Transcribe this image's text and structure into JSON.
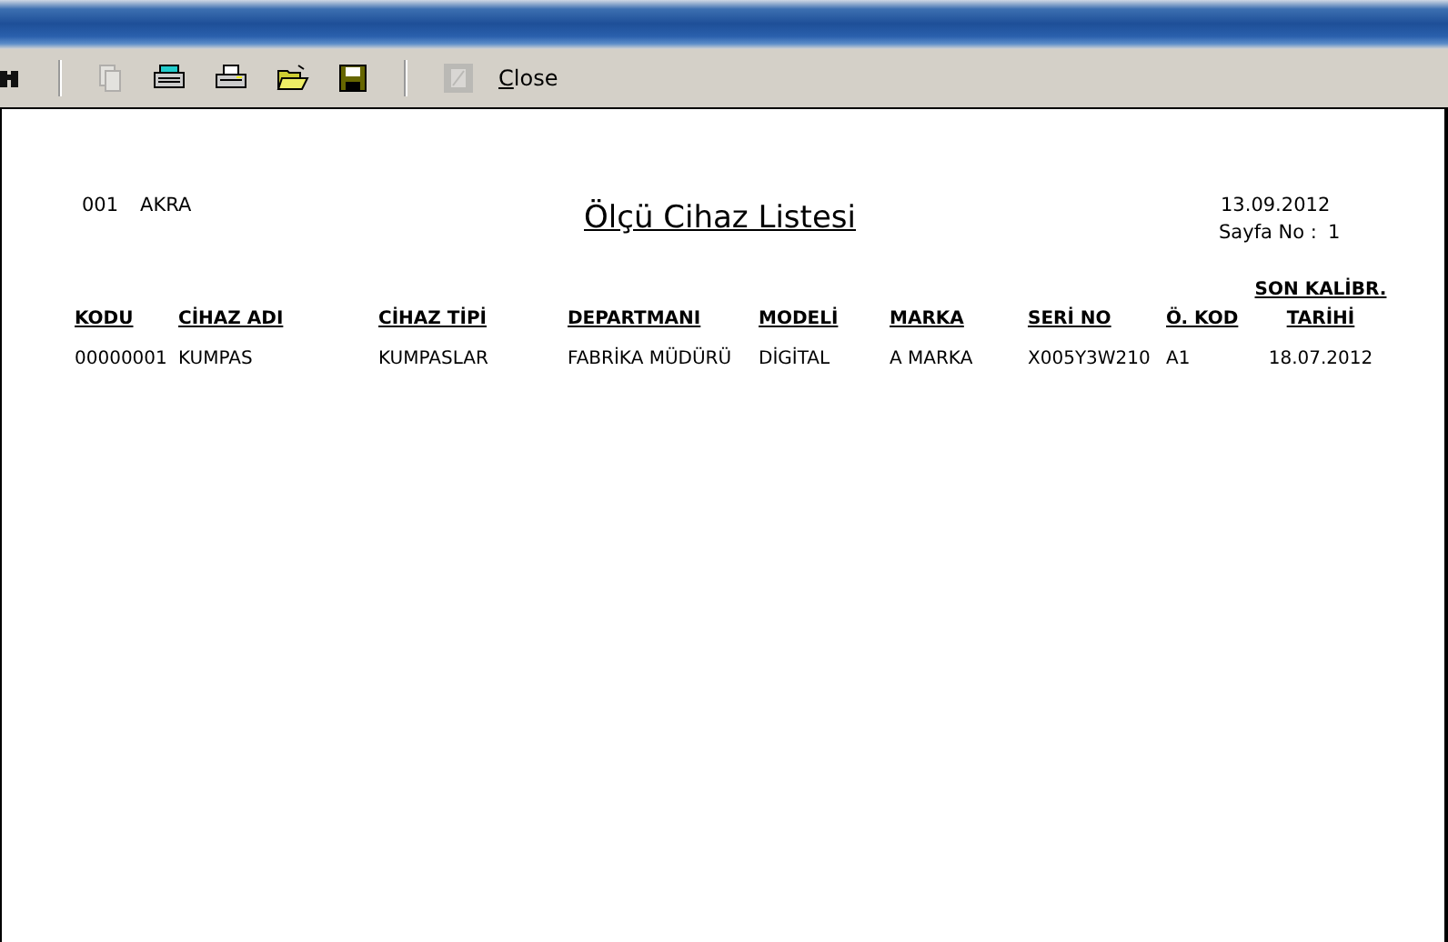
{
  "toolbar": {
    "buttons": [
      {
        "kind": "binoculars",
        "disabled": false
      },
      {
        "kind": "separator"
      },
      {
        "kind": "page",
        "disabled": true
      },
      {
        "kind": "printer-setup",
        "disabled": false
      },
      {
        "kind": "printer",
        "disabled": false
      },
      {
        "kind": "open",
        "disabled": false
      },
      {
        "kind": "save",
        "disabled": false
      },
      {
        "kind": "separator"
      },
      {
        "kind": "export",
        "disabled": true
      },
      {
        "kind": "text",
        "label": "Close",
        "disabled": false
      }
    ]
  },
  "report": {
    "company_code": "001",
    "company_name": "AKRA",
    "title": "Ölçü Cihaz Listesi",
    "date": "13.09.2012",
    "page_label": "Sayfa No :",
    "page_number": "1",
    "columns": [
      "KODU",
      "CİHAZ ADI",
      "CİHAZ TİPİ",
      "DEPARTMANI",
      "MODELİ",
      "MARKA",
      "SERİ NO",
      "Ö. KOD",
      "SON KALİBR.\nTARİHİ"
    ],
    "rows": [
      [
        "00000001",
        "KUMPAS",
        "KUMPASLAR",
        "FABRİKA MÜDÜRÜ",
        "DİGİTAL",
        "A MARKA",
        "X005Y3W210",
        "A1",
        "18.07.2012"
      ]
    ]
  }
}
